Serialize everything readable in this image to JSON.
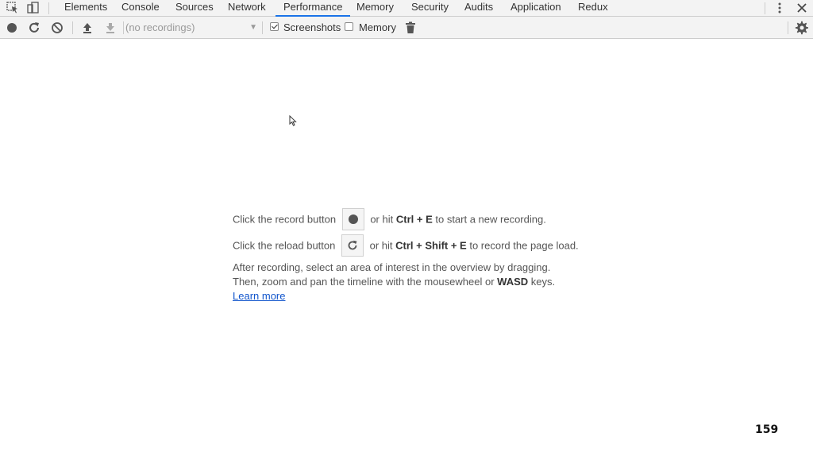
{
  "tabs": [
    {
      "label": "Elements",
      "active": false
    },
    {
      "label": "Console",
      "active": false
    },
    {
      "label": "Sources",
      "active": false
    },
    {
      "label": "Network",
      "active": false
    },
    {
      "label": "Performance",
      "active": true
    },
    {
      "label": "Memory",
      "active": false
    },
    {
      "label": "Security",
      "active": false
    },
    {
      "label": "Audits",
      "active": false
    },
    {
      "label": "Application",
      "active": false
    },
    {
      "label": "Redux",
      "active": false
    }
  ],
  "toolbar": {
    "recordings_placeholder": "(no recordings)",
    "screenshots_label": "Screenshots",
    "screenshots_checked": true,
    "memory_label": "Memory",
    "memory_checked": false
  },
  "landing": {
    "line1_pre": "Click the record button",
    "line1_mid": "or hit",
    "line1_keys": "Ctrl + E",
    "line1_post": "to start a new recording.",
    "line2_pre": "Click the reload button",
    "line2_mid": "or hit",
    "line2_keys": "Ctrl + Shift + E",
    "line2_post": "to record the page load.",
    "line3": "After recording, select an area of interest in the overview by dragging.",
    "line4_pre": "Then, zoom and pan the timeline with the mousewheel or",
    "line4_keys": "WASD",
    "line4_post": "keys.",
    "learn_more": "Learn more"
  },
  "page_number": "159",
  "colors": {
    "accent": "#1a73e8",
    "link": "#1155cc"
  }
}
